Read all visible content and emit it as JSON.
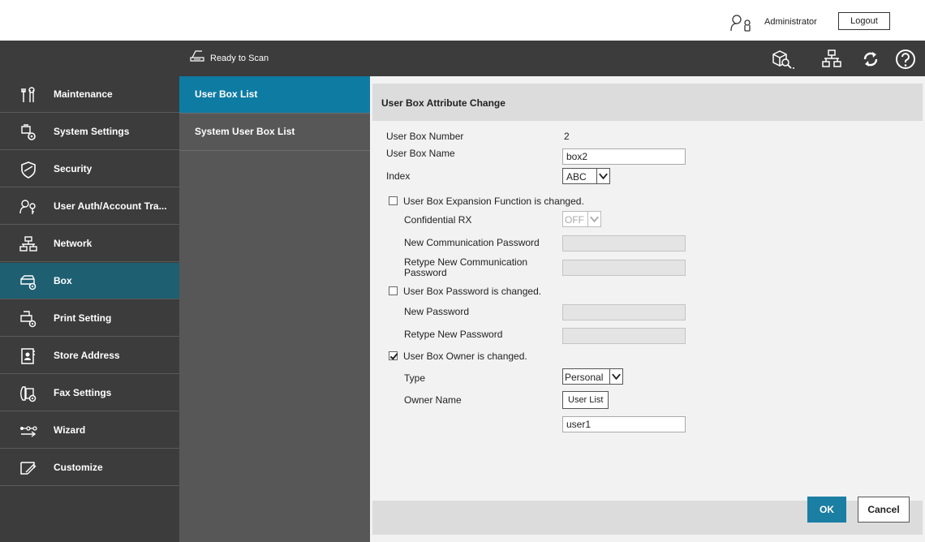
{
  "header": {
    "user_icon": "user-key-icon",
    "user_name": "Administrator",
    "logout_label": "Logout"
  },
  "status": {
    "icon": "scanner-icon",
    "text": "Ready to Scan"
  },
  "toolbar": {
    "icons": [
      "box-search-icon",
      "network-icon",
      "refresh-icon",
      "help-icon"
    ]
  },
  "sidebar": {
    "items": [
      {
        "label": "Maintenance",
        "icon": "maintenance-icon"
      },
      {
        "label": "System Settings",
        "icon": "system-settings-icon"
      },
      {
        "label": "Security",
        "icon": "shield-icon"
      },
      {
        "label": "User Auth/Account Tra...",
        "icon": "user-auth-icon"
      },
      {
        "label": "Network",
        "icon": "network-icon"
      },
      {
        "label": "Box",
        "icon": "box-icon",
        "active": true
      },
      {
        "label": "Print Setting",
        "icon": "print-setting-icon"
      },
      {
        "label": "Store Address",
        "icon": "address-book-icon"
      },
      {
        "label": "Fax Settings",
        "icon": "fax-icon"
      },
      {
        "label": "Wizard",
        "icon": "wizard-icon"
      },
      {
        "label": "Customize",
        "icon": "customize-icon"
      }
    ]
  },
  "subnav": {
    "items": [
      {
        "label": "User Box List",
        "active": true
      },
      {
        "label": "System User Box List"
      }
    ]
  },
  "form": {
    "title": "User Box Attribute Change",
    "box_number_label": "User Box Number",
    "box_number_value": "2",
    "box_name_label": "User Box Name",
    "box_name_value": "box2",
    "index_label": "Index",
    "index_value": "ABC",
    "expansion_label": "User Box Expansion Function is changed.",
    "expansion_checked": false,
    "confidential_label": "Confidential RX",
    "confidential_value": "OFF",
    "new_comm_pw_label": "New Communication Password",
    "retype_comm_pw_label_1": "Retype New Communication",
    "retype_comm_pw_label_2": "Password",
    "password_changed_label": "User Box Password is changed.",
    "password_changed_checked": false,
    "new_pw_label": "New Password",
    "retype_pw_label": "Retype New Password",
    "owner_changed_label": "User Box Owner is changed.",
    "owner_changed_checked": true,
    "type_label": "Type",
    "type_value": "Personal",
    "owner_name_label": "Owner Name",
    "user_list_label": "User List",
    "owner_name_value": "user1"
  },
  "footer": {
    "ok_label": "OK",
    "cancel_label": "Cancel"
  }
}
